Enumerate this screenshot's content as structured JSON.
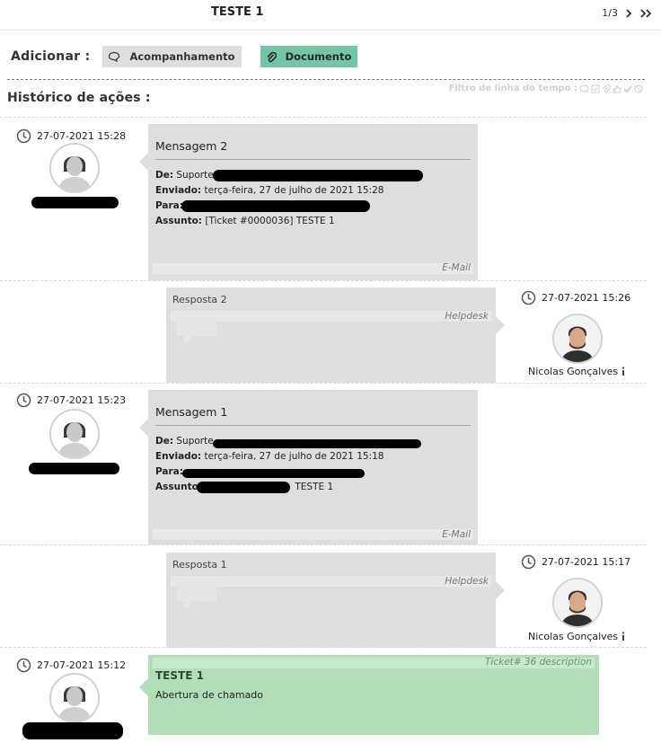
{
  "header": {
    "ticket_title": "TESTE 1",
    "pager_text": "1/3"
  },
  "actions": {
    "add_label": "Adicionar :",
    "followup_label": "Acompanhamento",
    "document_label": "Documento"
  },
  "history": {
    "title": "Histórico de ações :",
    "filter_label": "Filtro de linha do tempo :"
  },
  "timeline": [
    {
      "date": "27-07-2021 15:28",
      "title": "Mensagem 2",
      "headers": [
        {
          "label": "De:",
          "value": "Suporte"
        },
        {
          "label": "Enviado:",
          "value": "terça-feira, 27 de julho de 2021 15:28"
        },
        {
          "label": "Para:",
          "value": ""
        },
        {
          "label": "Assunto:",
          "value": "[Ticket #0000036] TESTE 1"
        }
      ],
      "source": "E-Mail"
    },
    {
      "date": "27-07-2021 15:26",
      "title": "Resposta 2",
      "source": "Helpdesk",
      "user": "Nicolas Gonçalves"
    },
    {
      "date": "27-07-2021 15:23",
      "title": "Mensagem 1",
      "headers": [
        {
          "label": "De:",
          "value": "Suporte"
        },
        {
          "label": "Enviado:",
          "value": "terça-feira, 27 de julho de 2021 15:18"
        },
        {
          "label": "Para:",
          "value": ""
        },
        {
          "label": "Assunto:",
          "value": "TESTE 1"
        }
      ],
      "source": "E-Mail"
    },
    {
      "date": "27-07-2021 15:17",
      "title": "Resposta 1",
      "source": "Helpdesk",
      "user": "Nicolas Gonçalves"
    },
    {
      "date": "27-07-2021 15:12",
      "title": "TESTE 1",
      "body": "Abertura de chamado",
      "source": "Ticket# 36 description"
    }
  ],
  "colors": {
    "accent": "#74c5a4",
    "bubble": "#dedede",
    "green_card": "#b1deb7"
  }
}
